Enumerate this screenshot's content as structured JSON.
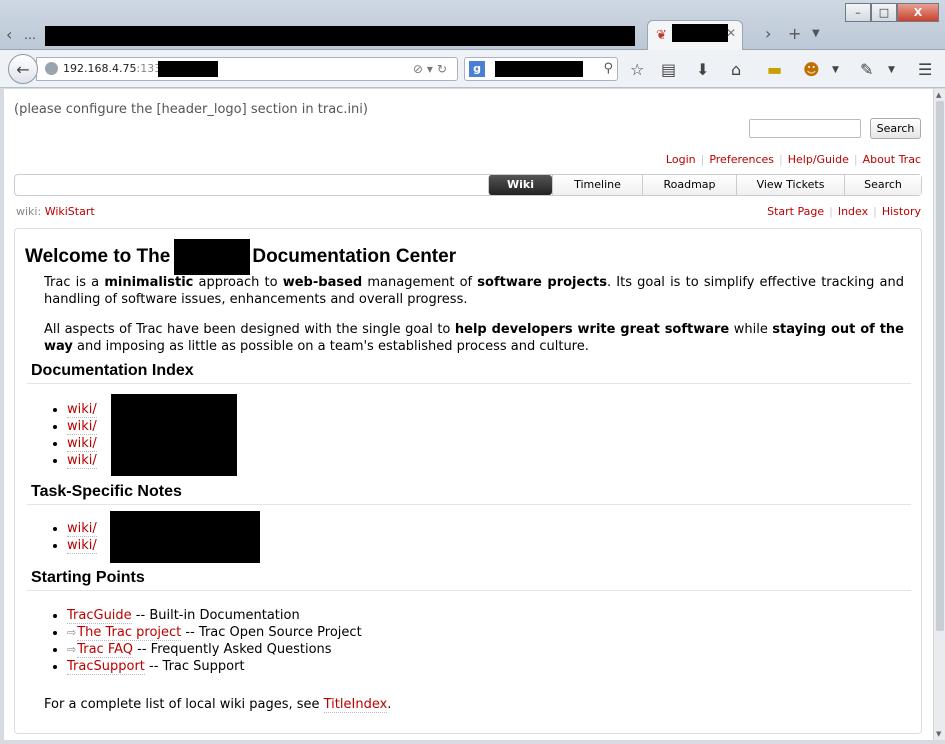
{
  "browser": {
    "url_host": "192.168.4.75",
    "url_port": ":1337/",
    "search_engine": "g",
    "window_controls": [
      "–",
      "□",
      "X"
    ]
  },
  "trac": {
    "header_logo_message": "(please configure the [header_logo] section in trac.ini)",
    "search_button": "Search",
    "metanav": [
      "Login",
      "Preferences",
      "Help/Guide",
      "About Trac"
    ],
    "mainnav": [
      {
        "label": "Wiki",
        "active": true
      },
      {
        "label": "Timeline",
        "active": false
      },
      {
        "label": "Roadmap",
        "active": false
      },
      {
        "label": "View Tickets",
        "active": false
      },
      {
        "label": "Search",
        "active": false
      }
    ],
    "breadcrumb_prefix": "wiki:",
    "breadcrumb_page": "WikiStart",
    "ctxtnav": [
      "Start Page",
      "Index",
      "History"
    ]
  },
  "content": {
    "title_before": "Welcome to The",
    "title_after": "Documentation Center",
    "intro1": {
      "p1": "Trac is a ",
      "b1": "minimalistic",
      "p2": " approach to ",
      "b2": "web-based",
      "p3": " management of ",
      "b3": "software projects",
      "p4": ". Its goal is to simplify effective tracking and handling of software issues, enhancements and overall progress."
    },
    "intro2": {
      "p1": "All aspects of Trac have been designed with the single goal to ",
      "b1": "help developers write great software",
      "p2": " while ",
      "b2": "staying out of the way",
      "p3": " and imposing as little as possible on a team's established process and culture."
    },
    "sections": {
      "doc_index": "Documentation Index",
      "task_notes": "Task-Specific Notes",
      "starting_points": "Starting Points"
    },
    "doc_index_links": [
      "wiki/",
      "wiki/",
      "wiki/",
      "wiki/"
    ],
    "task_notes_links": [
      "wiki/",
      "wiki/"
    ],
    "starting_points": [
      {
        "link": "TracGuide",
        "desc": " -- Built-in Documentation",
        "external": false
      },
      {
        "link": "The Trac project",
        "desc": " -- Trac Open Source Project",
        "external": true
      },
      {
        "link": "Trac FAQ",
        "desc": " -- Frequently Asked Questions",
        "external": true
      },
      {
        "link": "TracSupport",
        "desc": " -- Trac Support",
        "external": false
      }
    ],
    "footer_text": "For a complete list of local wiki pages, see ",
    "footer_link": "TitleIndex",
    "footer_end": "."
  }
}
